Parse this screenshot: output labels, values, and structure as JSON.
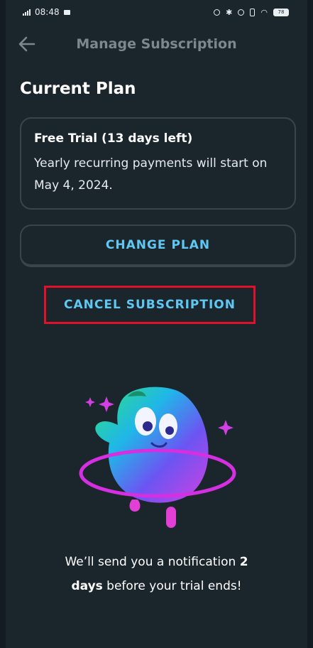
{
  "status_bar": {
    "time": "08:48",
    "battery": "78"
  },
  "header": {
    "title": "Manage Subscription"
  },
  "current_plan": {
    "section_title": "Current Plan",
    "plan_name": "Free Trial (13 days left)",
    "description": "Yearly recurring payments will start on May 4, 2024."
  },
  "actions": {
    "change_plan": "CHANGE PLAN",
    "cancel_subscription": "CANCEL SUBSCRIPTION"
  },
  "notification": {
    "part1": "We’ll send you a notification ",
    "bold1": "2",
    "bold2": "days",
    "part2": " before your trial ends!"
  },
  "colors": {
    "background": "#1a252c",
    "accent": "#60c7f2",
    "highlight": "#e0112a"
  }
}
